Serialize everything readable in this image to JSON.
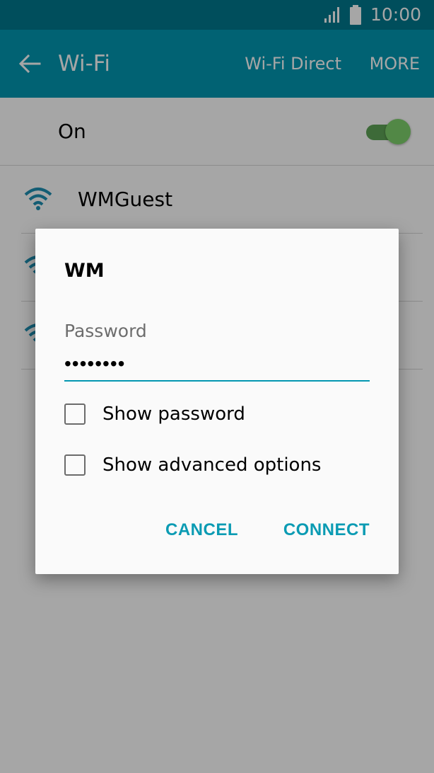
{
  "status_bar": {
    "time": "10:00",
    "signal_icon": "signal-icon",
    "battery_icon": "battery-icon"
  },
  "app_bar": {
    "title": "Wi-Fi",
    "back_icon": "back-arrow-icon",
    "action_wifi_direct": "Wi-Fi Direct",
    "action_more": "MORE"
  },
  "wifi_toggle": {
    "label": "On",
    "state": "on"
  },
  "networks": [
    {
      "name": "WMGuest",
      "icon": "wifi-icon"
    },
    {
      "name": "",
      "icon": "wifi-icon"
    },
    {
      "name": "",
      "icon": "wifi-icon"
    }
  ],
  "dialog": {
    "title": "WM",
    "password_label": "Password",
    "password_value": "••••••••",
    "show_password_label": "Show password",
    "show_advanced_label": "Show advanced options",
    "cancel_label": "CANCEL",
    "connect_label": "CONNECT"
  },
  "colors": {
    "status_bar": "#01788e",
    "app_bar": "#0397b1",
    "accent": "#0b9bb3",
    "switch_on": "#7ed26c"
  }
}
